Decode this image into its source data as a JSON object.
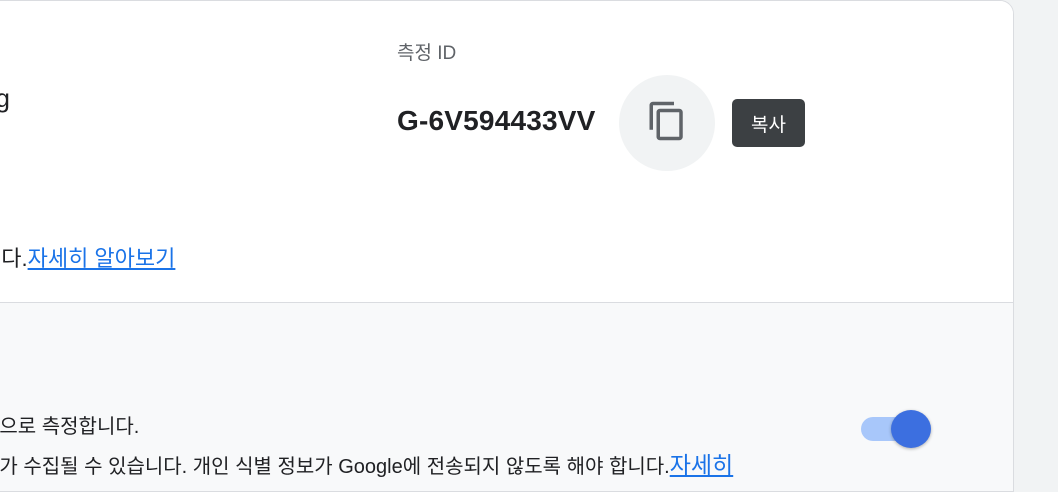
{
  "stream": {
    "name_fragment": "og"
  },
  "measurement": {
    "label": "측정 ID",
    "value": "G-6V594433VV",
    "copy_tooltip": "복사"
  },
  "info": {
    "text_fragment": "니다.",
    "learn_more": "자세히 알아보기"
  },
  "enhanced": {
    "line1": "등으로 측정합니다.",
    "line2": "터가 수집될 수 있습니다. 개인 식별 정보가 Google에 전송되지 않도록 해야 합니다.",
    "learn_more": "자세히",
    "toggle_on": true
  },
  "colors": {
    "link": "#1a73e8",
    "toggle_track": "#a8c7fa",
    "toggle_knob": "#3c6fe0",
    "tooltip_bg": "#3c4043"
  },
  "icons": {
    "copy": "copy-icon"
  }
}
